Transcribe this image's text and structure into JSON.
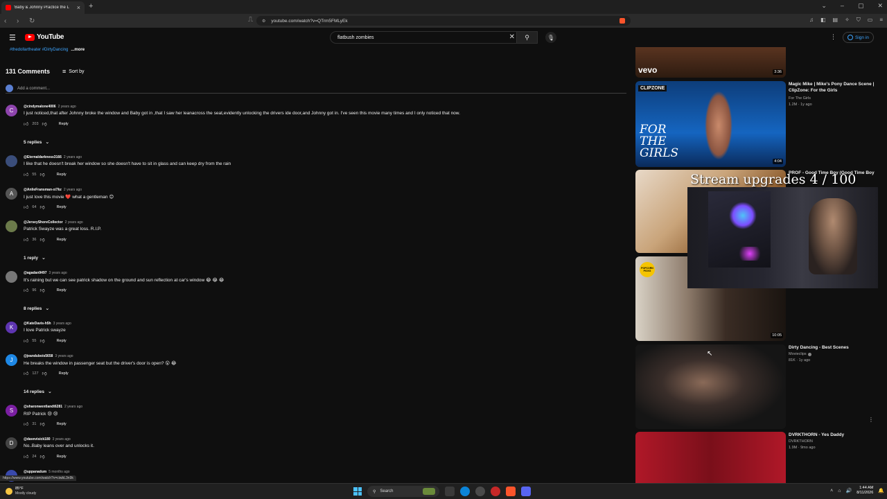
{
  "browser": {
    "tab_title": "'Baby & Johnny Practice the L",
    "url": "youtube.com/watch?v=QTrm5FMLyEk",
    "status_url": "https://www.youtube.com/watch?v=ciwbL3n9k"
  },
  "masthead": {
    "logo_text": "YouTube",
    "search_query": "flatbush zombies",
    "signin_label": "Sign in"
  },
  "description": {
    "hashtags": "#thedollartheater #DirtyDancing",
    "more_label": "...more"
  },
  "comments_header": {
    "count_label": "131 Comments",
    "sort_label": "Sort by",
    "add_placeholder": "Add a comment..."
  },
  "comments": [
    {
      "author": "@cindymalone4006",
      "time": "2 years ago",
      "text": "I just noticed,that after Johnny broke the window and Baby got in ,that I saw her leanacross the seat,evidently unlocking the drivers  ide door,and Johnny got in. I've seen this movie many times and I only noticed that now.",
      "likes": "203",
      "initial": "C",
      "color": "#8e44ad",
      "replies": "5 replies"
    },
    {
      "author": "@Eternaldarkness3166",
      "time": "2 years ago",
      "text": "I like that he doesn't break her window so she doesn't have to sit in glass and can keep dry from the rain",
      "likes": "55",
      "initial": "",
      "color": "#3a4d7a",
      "replies": ""
    },
    {
      "author": "@AnlieFransman-xi7kz",
      "time": "2 years ago",
      "text": "I just love this movie ❤️ what a gentleman 😊",
      "likes": "64",
      "initial": "A",
      "color": "#555555",
      "replies": ""
    },
    {
      "author": "@JerseyShoreCollector",
      "time": "2 years ago",
      "text": "Patrick Swayze was a great loss.  R.I.P.",
      "likes": "36",
      "initial": "",
      "color": "#6b7a4a",
      "replies": "1 reply"
    },
    {
      "author": "@agadan9497",
      "time": "3 years ago",
      "text": "It's raining but we can see patrick shadow on the ground and sun reflection at car's window 😂 😂 😂",
      "likes": "96",
      "initial": "",
      "color": "#777777",
      "replies": "8 replies"
    },
    {
      "author": "@KateDavis-h5h",
      "time": "3 years ago",
      "text": "I love Patrick swayze",
      "likes": "55",
      "initial": "K",
      "color": "#5e35b1",
      "replies": ""
    },
    {
      "author": "@jeandubois5658",
      "time": "3 years ago",
      "text": "He breaks the window in passenger seat but the driver's door is open? 😮 😂",
      "likes": "127",
      "initial": "J",
      "color": "#1e88e5",
      "replies": "14 replies"
    },
    {
      "author": "@sharonwentlandt6281",
      "time": "2 years ago",
      "text": "RIP Patrick 😢 😢",
      "likes": "31",
      "initial": "S",
      "color": "#7b1fa2",
      "replies": ""
    },
    {
      "author": "@davevisick180",
      "time": "3 years ago",
      "text": "No..Baby leans over and unlocks it.",
      "likes": "24",
      "initial": "D",
      "color": "#444444",
      "replies": ""
    },
    {
      "author": "@uppanadum",
      "time": "5 months ago",
      "text": "oodl!",
      "likes": "",
      "initial": "",
      "color": "#3949ab",
      "replies": ""
    }
  ],
  "comment_actions": {
    "reply_label": "Reply"
  },
  "sidebar": [
    {
      "title": "",
      "channel": "",
      "stats": "",
      "duration": "3:36",
      "badge": "vevo"
    },
    {
      "title": "Magic Mike | Mike's Pony Dance Scene | ClipZone: For the Girls",
      "channel": "For The Girls",
      "stats": "1.2M · 1y ago",
      "duration": "4:04",
      "badge": "CLIPZONE",
      "thumb_caption": "FOR THE GIRLS"
    },
    {
      "title": "PROF - Good Time Boy (Good Time Boy",
      "channel": "",
      "stats": "",
      "duration": "",
      "badge": ""
    },
    {
      "title": "",
      "channel": "",
      "stats": "",
      "duration": "10:05",
      "badge": "POPCORN PICKS"
    },
    {
      "title": "Dirty Dancing - Best Scenes",
      "channel": "Movieclips",
      "stats": "81K · 1y ago",
      "duration": "",
      "badge": ""
    },
    {
      "title": "DVRKTHORN - Yes Daddy",
      "channel": "DVRKTHORN",
      "stats": "1.9M · 9mo ago",
      "duration": "",
      "badge": ""
    }
  ],
  "overlay": {
    "title": "Stream upgrades 4 / 100"
  },
  "taskbar": {
    "temp": "85°F",
    "weather": "Mostly cloudy",
    "search_label": "Search",
    "time": "1:44 AM",
    "date": "8/11/2026"
  }
}
